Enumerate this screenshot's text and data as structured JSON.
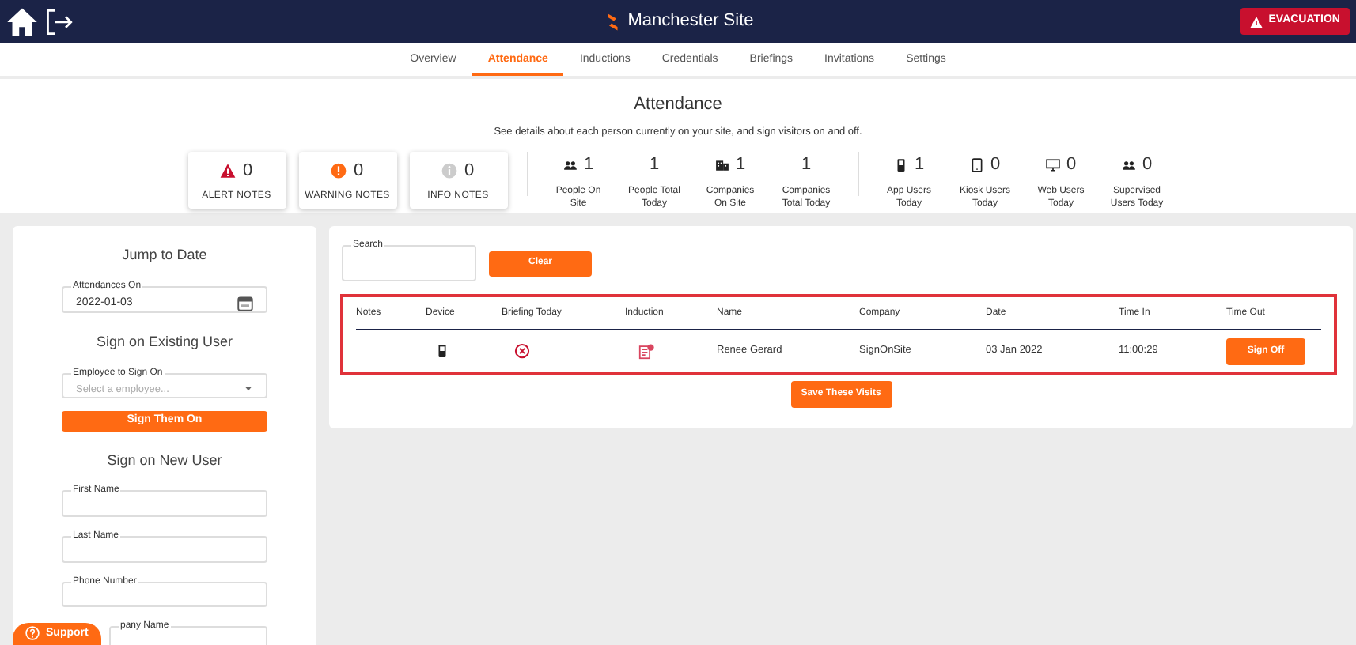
{
  "header": {
    "title": "Manchester Site",
    "evacuation": "EVACUATION"
  },
  "tabs": [
    {
      "label": "Overview",
      "selected": false
    },
    {
      "label": "Attendance",
      "selected": true
    },
    {
      "label": "Inductions",
      "selected": false
    },
    {
      "label": "Credentials",
      "selected": false
    },
    {
      "label": "Briefings",
      "selected": false
    },
    {
      "label": "Invitations",
      "selected": false
    },
    {
      "label": "Settings",
      "selected": false
    }
  ],
  "summary": {
    "title": "Attendance",
    "subtitle": "See details about each person currently on your site, and sign visitors on and off.",
    "notes": [
      {
        "kind": "alert",
        "count": "0",
        "label": "ALERT NOTES"
      },
      {
        "kind": "warning",
        "count": "0",
        "label": "WARNING NOTES"
      },
      {
        "kind": "info",
        "count": "0",
        "label": "INFO NOTES"
      }
    ],
    "stat_groups": [
      [
        {
          "kind": "people",
          "count": "1",
          "label": "People On Site"
        },
        {
          "kind": "plain",
          "count": "1",
          "label": "People Total Today"
        },
        {
          "kind": "building",
          "count": "1",
          "label": "Companies On Site"
        },
        {
          "kind": "plain",
          "count": "1",
          "label": "Companies Total Today"
        }
      ],
      [
        {
          "kind": "phone",
          "count": "1",
          "label": "App Users Today"
        },
        {
          "kind": "tablet",
          "count": "0",
          "label": "Kiosk Users Today"
        },
        {
          "kind": "monitor",
          "count": "0",
          "label": "Web Users Today"
        },
        {
          "kind": "people",
          "count": "0",
          "label": "Supervised Users Today"
        }
      ]
    ]
  },
  "side": [
    {
      "kind": "heading",
      "text": "Jump to Date"
    },
    {
      "kind": "date",
      "label": "Attendances On",
      "value": "2022-01-03"
    },
    {
      "kind": "heading",
      "text": "Sign on Existing User"
    },
    {
      "kind": "select",
      "label": "Employee to Sign On",
      "placeholder": "Select a employee..."
    },
    {
      "kind": "button",
      "text": "Sign Them On"
    },
    {
      "kind": "heading",
      "text": "Sign on New User"
    },
    {
      "kind": "field",
      "label": "First Name"
    },
    {
      "kind": "field",
      "label": "Last Name"
    },
    {
      "kind": "field",
      "label": "Phone Number"
    },
    {
      "kind": "field",
      "label": "pany Name"
    }
  ],
  "search": {
    "label": "Search",
    "clear": "Clear"
  },
  "table": {
    "columns": [
      "Notes",
      "Device",
      "Briefing Today",
      "Induction",
      "Name",
      "Company",
      "Date",
      "Time In",
      "Time Out"
    ],
    "rows": [
      {
        "name": "Renee Gerard",
        "company": "SignOnSite",
        "date": "03 Jan 2022",
        "time_in": "11:00:29",
        "action": "Sign Off"
      }
    ]
  },
  "save": "Save These Visits",
  "support": "Support"
}
